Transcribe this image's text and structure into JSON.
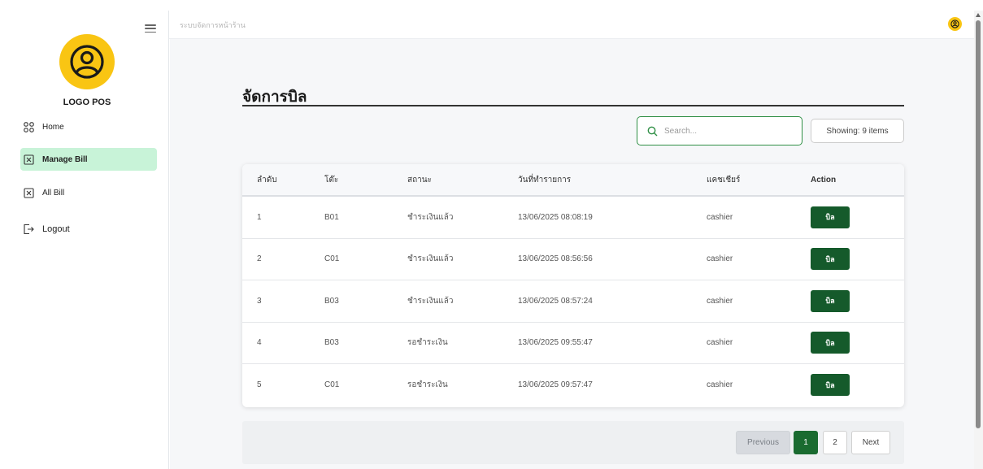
{
  "app": {
    "logo_text": "LOGO POS",
    "topbar_title": "ระบบจัดการหน้าร้าน"
  },
  "sidebar": {
    "items": [
      {
        "label": "Home",
        "icon": "grid-icon"
      },
      {
        "label": "Manage Bill",
        "icon": "receipt-icon",
        "active": true
      },
      {
        "label": "All Bill",
        "icon": "receipt-icon"
      },
      {
        "label": "Logout",
        "icon": "logout-icon"
      }
    ]
  },
  "main": {
    "title": "จัดการบิล",
    "search": {
      "placeholder": "Search...",
      "value": ""
    },
    "showing": "Showing: 9 items",
    "table": {
      "headers": [
        "ลำดับ",
        "โต๊ะ",
        "สถานะ",
        "วันที่ทำรายการ",
        "แคชเชียร์",
        "Action"
      ],
      "rows": [
        {
          "no": "1",
          "table": "B01",
          "status": "ชำระเงินแล้ว",
          "date": "13/06/2025 08:08:19",
          "cashier": "cashier",
          "action": "บิล"
        },
        {
          "no": "2",
          "table": "C01",
          "status": "ชำระเงินแล้ว",
          "date": "13/06/2025 08:56:56",
          "cashier": "cashier",
          "action": "บิล"
        },
        {
          "no": "3",
          "table": "B03",
          "status": "ชำระเงินแล้ว",
          "date": "13/06/2025 08:57:24",
          "cashier": "cashier",
          "action": "บิล"
        },
        {
          "no": "4",
          "table": "B03",
          "status": "รอชำระเงิน",
          "date": "13/06/2025 09:55:47",
          "cashier": "cashier",
          "action": "บิล"
        },
        {
          "no": "5",
          "table": "C01",
          "status": "รอชำระเงิน",
          "date": "13/06/2025 09:57:47",
          "cashier": "cashier",
          "action": "บิล"
        }
      ]
    },
    "pagination": {
      "previous": "Previous",
      "pages": [
        "1",
        "2"
      ],
      "current": "1",
      "next": "Next"
    }
  },
  "colors": {
    "brand": "#f9c513",
    "primary_green": "#155a2b",
    "active_nav": "#c8f3d8",
    "search_border": "#2f8f45"
  }
}
